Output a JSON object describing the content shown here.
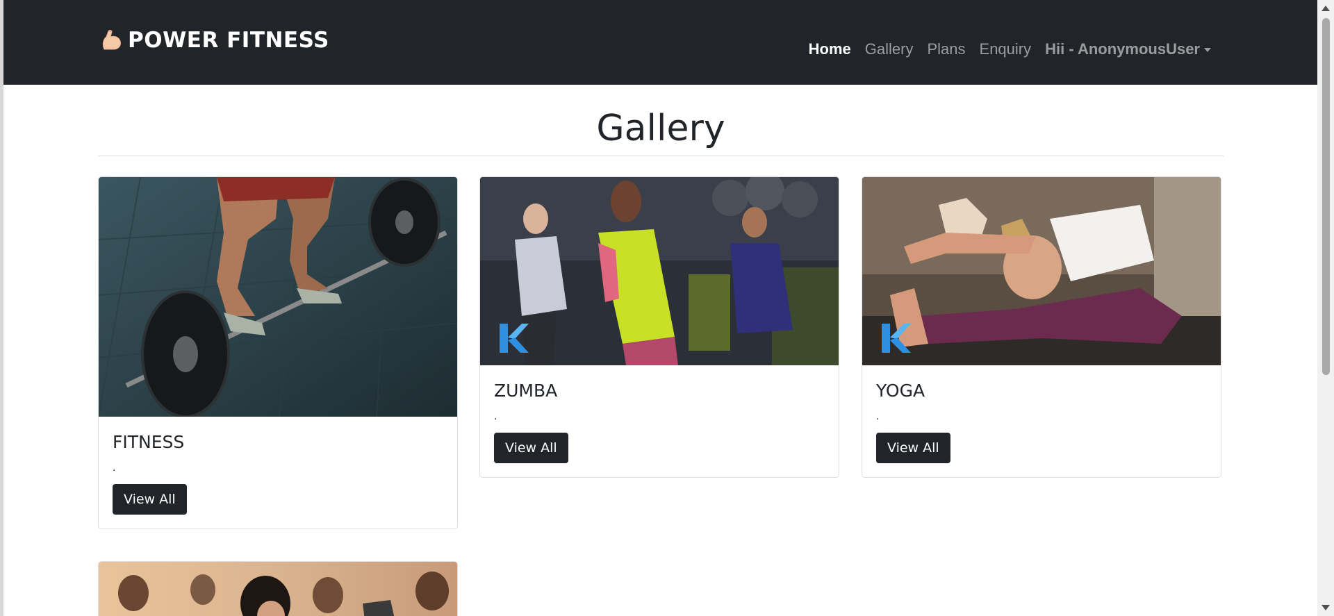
{
  "brand": {
    "icon": "flexed-biceps-icon",
    "name": "POWER FITNESS"
  },
  "nav": {
    "items": [
      {
        "label": "Home",
        "active": true
      },
      {
        "label": "Gallery",
        "active": false
      },
      {
        "label": "Plans",
        "active": false
      },
      {
        "label": "Enquiry",
        "active": false
      }
    ],
    "user_label": "Hii - AnonymousUser"
  },
  "page": {
    "title": "Gallery"
  },
  "cards": [
    {
      "title": "FITNESS",
      "text": ".",
      "button": "View All",
      "image": "barbell-deadlift-photo"
    },
    {
      "title": "ZUMBA",
      "text": ".",
      "button": "View All",
      "image": "zumba-dance-class-photo"
    },
    {
      "title": "YOGA",
      "text": ".",
      "button": "View All",
      "image": "yoga-stretch-photo"
    },
    {
      "title": "",
      "text": "",
      "button": "",
      "image": "group-workout-class-photo"
    }
  ],
  "colors": {
    "navbar": "#212529",
    "button": "#212529",
    "background": "#ffffff"
  }
}
